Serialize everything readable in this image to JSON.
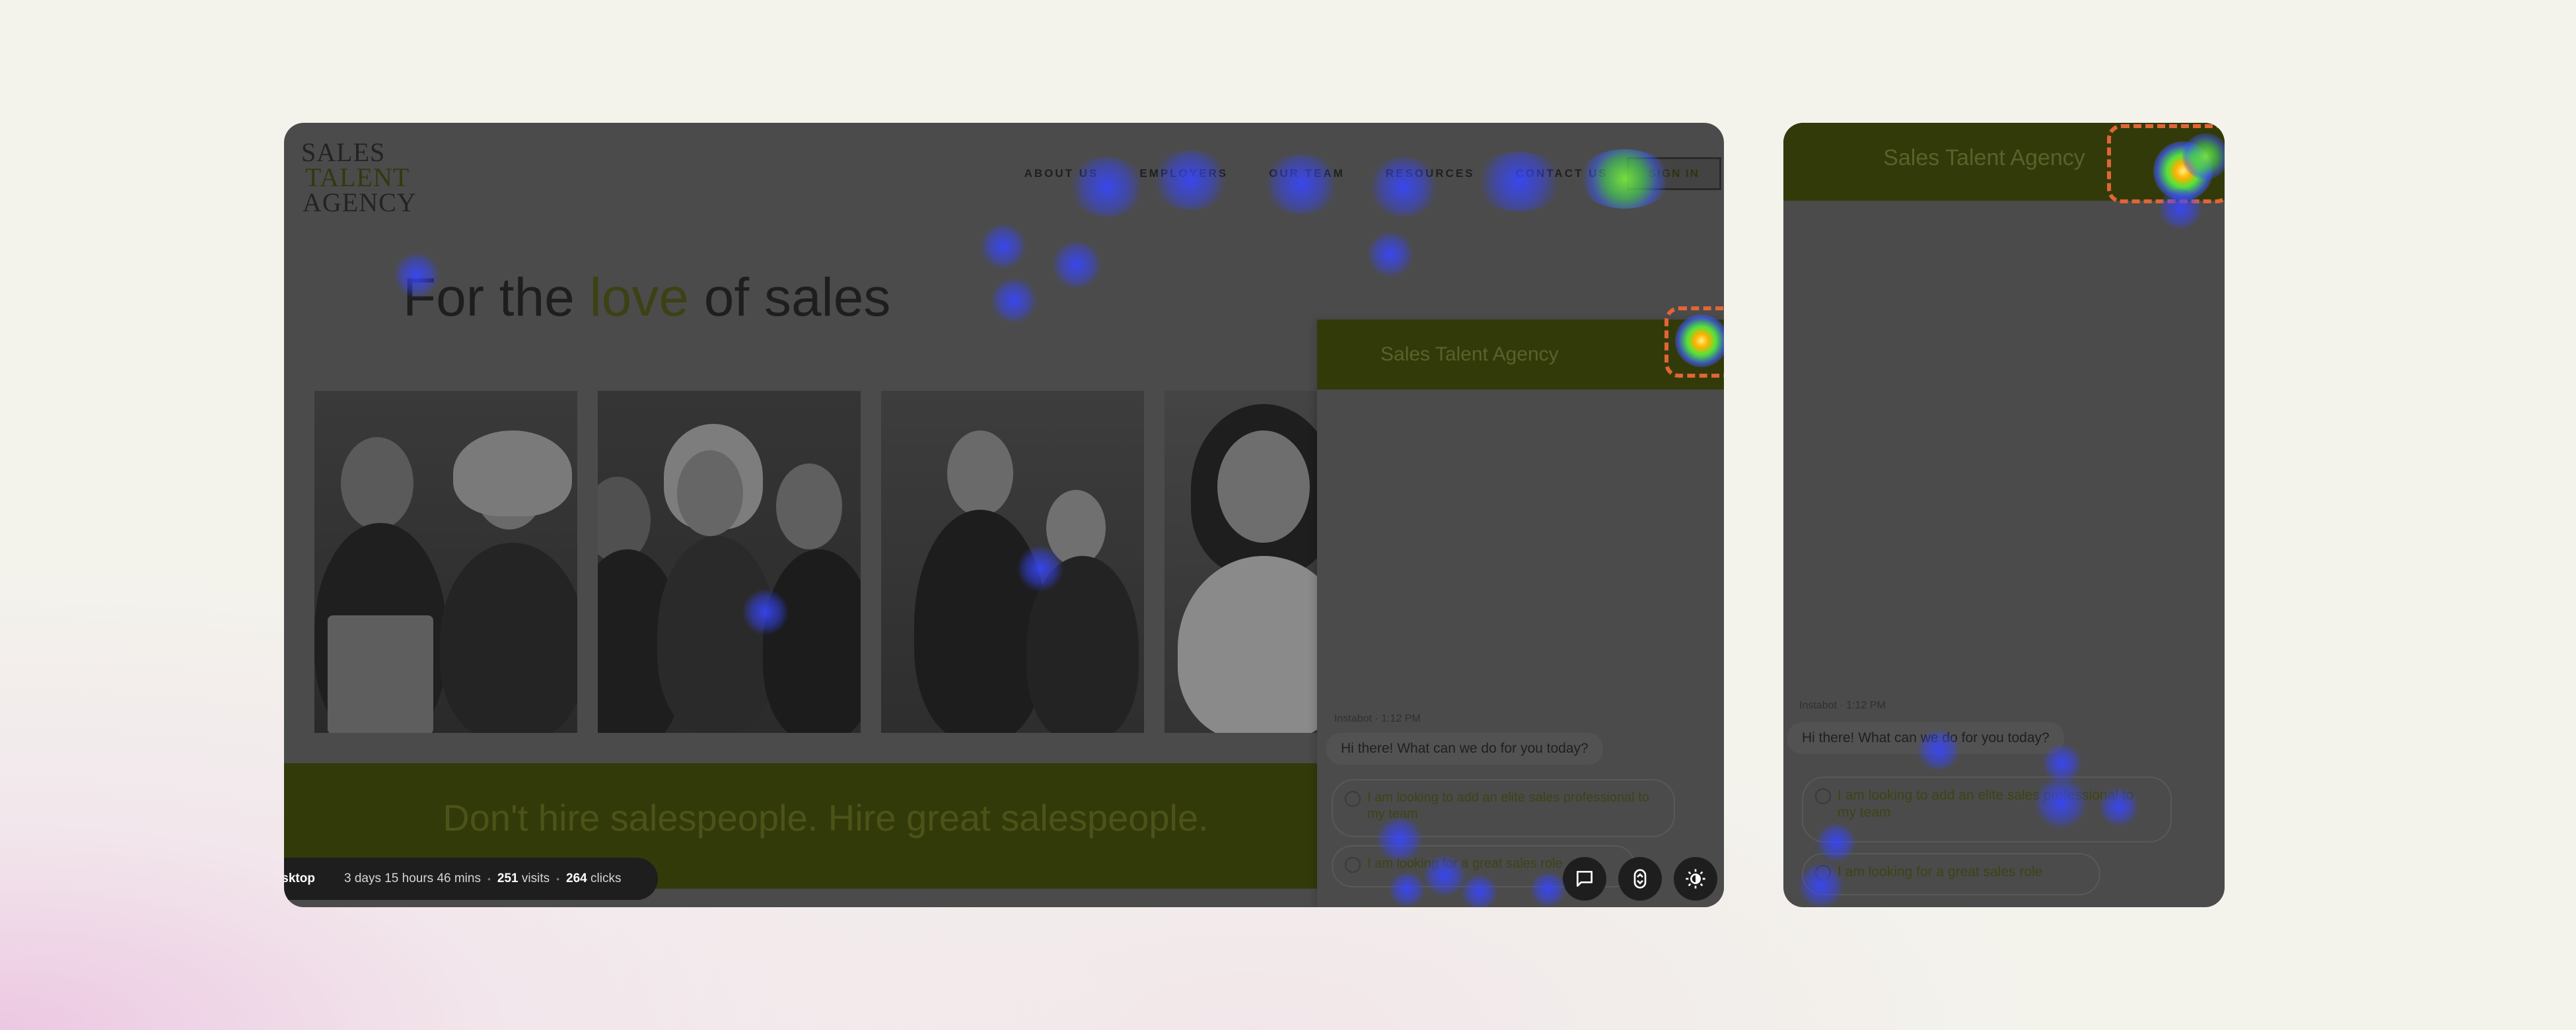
{
  "desktop": {
    "logo": {
      "line1": "SALES",
      "line2": "TALENT",
      "line3": "AGENCY"
    },
    "nav": {
      "items": [
        "ABOUT US",
        "EMPLOYERS",
        "OUR TEAM",
        "RESOURCES",
        "CONTACT US"
      ],
      "cta_label": "SIGN IN"
    },
    "hero": {
      "title_pre": "For the ",
      "title_accent": "love",
      "title_post": " of sales"
    },
    "banner_text": "Don't hire salespeople. Hire great salespeople.",
    "chat": {
      "title": "Sales Talent Agency",
      "meta": "Instabot · 1:12 PM",
      "greeting": "Hi there! What can we do for you today?",
      "option1": "I am looking to add an elite sales professional to my team",
      "option2": "I am looking for a great sales role"
    },
    "stats": {
      "device": "Desktop",
      "duration": "3 days 15 hours 46 mins",
      "visits_count": "251",
      "visits_label": "visits",
      "clicks_count": "264",
      "clicks_label": "clicks"
    },
    "tools": [
      "comment-icon",
      "scroll-icon",
      "brightness-icon"
    ]
  },
  "mobile": {
    "chat": {
      "title": "Sales Talent Agency",
      "meta": "Instabot · 1:12 PM",
      "greeting": "Hi there! What can we do for you today?",
      "option1": "I am looking to add an elite sales professional to my team",
      "option2": "I am looking for a great sales role"
    }
  },
  "colors": {
    "background": "#f3f3ec",
    "overlay": "#4b4b4b",
    "brand_olive": "#333a0a",
    "highlight_dash": "#e16536",
    "pill": "#1e1e1e"
  }
}
